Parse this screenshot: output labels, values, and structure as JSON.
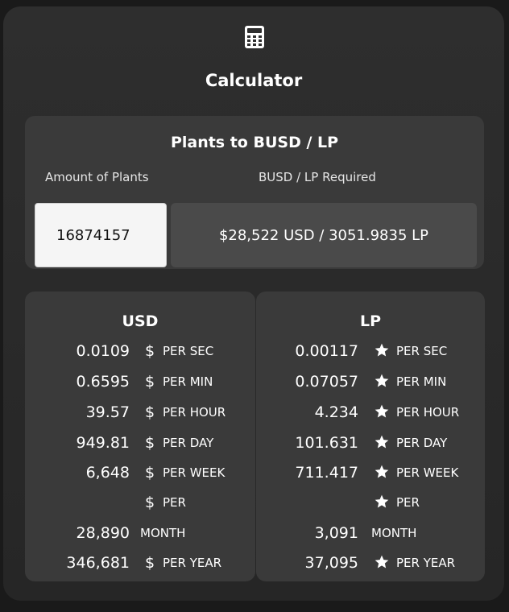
{
  "header": {
    "icon": "calculator-icon",
    "title": "Calculator"
  },
  "converter": {
    "title": "Plants to BUSD / LP",
    "amount_label": "Amount of Plants",
    "required_label": "BUSD / LP Required",
    "amount_value": "16874157",
    "result": "$28,522 USD / 3051.9835 LP"
  },
  "usd": {
    "title": "USD",
    "symbol": "$",
    "rows": [
      {
        "value": "0.0109",
        "unit": "PER SEC"
      },
      {
        "value": "0.6595",
        "unit": "PER MIN"
      },
      {
        "value": "39.57",
        "unit": "PER HOUR"
      },
      {
        "value": "949.81",
        "unit": "PER DAY"
      },
      {
        "value": "6,648",
        "unit": "PER WEEK"
      },
      {
        "value": "",
        "unit": "PER"
      },
      {
        "value": "28,890",
        "unit": "MONTH"
      },
      {
        "value": "346,681",
        "unit": "PER YEAR"
      }
    ]
  },
  "lp": {
    "title": "LP",
    "symbol": "star-icon",
    "rows": [
      {
        "value": "0.00117",
        "unit": "PER SEC"
      },
      {
        "value": "0.07057",
        "unit": "PER MIN"
      },
      {
        "value": "4.234",
        "unit": "PER HOUR"
      },
      {
        "value": "101.631",
        "unit": "PER DAY"
      },
      {
        "value": "711.417",
        "unit": "PER WEEK"
      },
      {
        "value": "",
        "unit": "PER"
      },
      {
        "value": "3,091",
        "unit": "MONTH"
      },
      {
        "value": "37,095",
        "unit": "PER YEAR"
      }
    ]
  },
  "colors": {
    "background": "#1a1a1a",
    "card": "#2e2e2e",
    "panel": "#3a3a3a",
    "result_box": "#4a4a4a",
    "text": "#ffffff"
  }
}
